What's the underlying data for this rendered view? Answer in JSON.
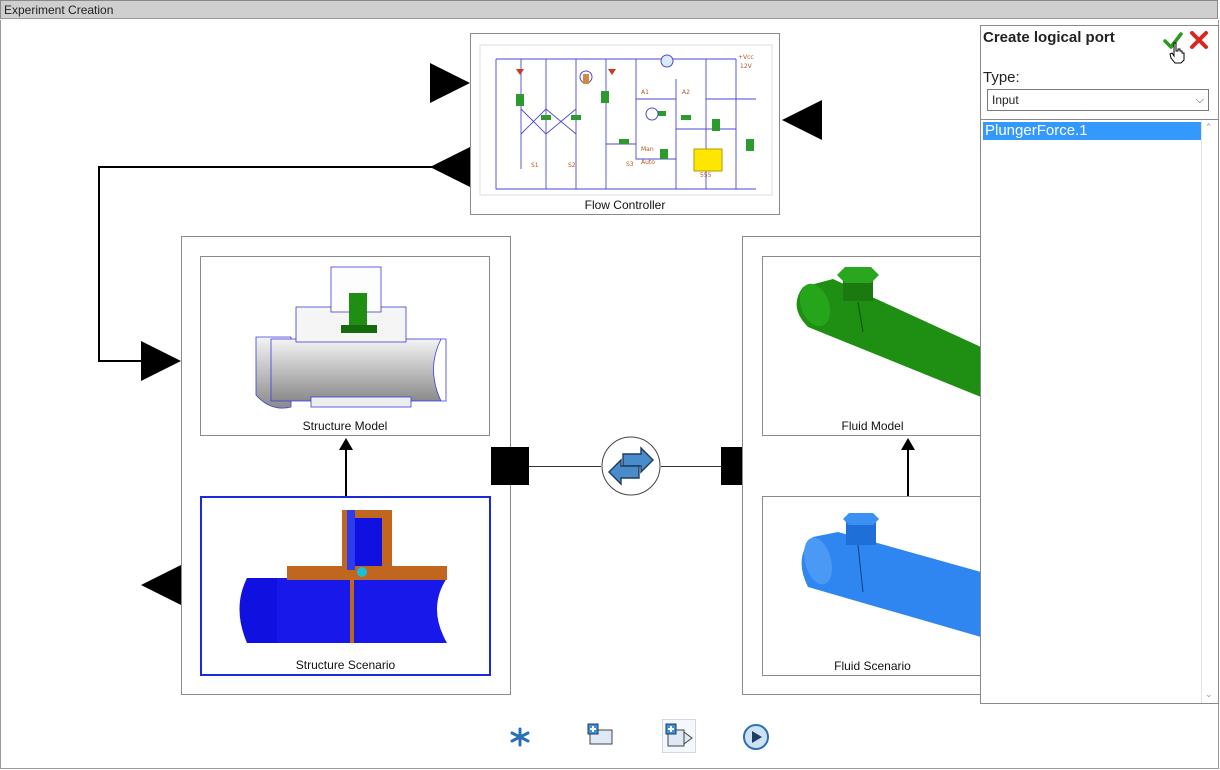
{
  "window": {
    "title": "Experiment Creation"
  },
  "nodes": {
    "flow_controller": "Flow Controller",
    "structure_model": "Structure Model",
    "structure_scenario": "Structure Scenario",
    "fluid_model": "Fluid Model",
    "fluid_scenario": "Fluid Scenario"
  },
  "schematic_labels": {
    "vcc": "+Vcc",
    "voltage": "12V",
    "ic": "555",
    "man": "Man",
    "auto": "Auto",
    "a1": "A1",
    "a2": "A2",
    "s1": "S1",
    "s2": "S2",
    "s3": "S3"
  },
  "panel": {
    "title": "Create logical port",
    "type_label": "Type:",
    "type_value": "Input",
    "items": [
      "PlungerForce.1"
    ]
  },
  "toolbar": {
    "icons": [
      "asterisk-icon",
      "add-container-icon",
      "add-container-arrow-icon",
      "play-icon"
    ]
  },
  "colors": {
    "selection_blue": "#3399ff",
    "selected_border": "#1a2bd6",
    "confirm_green": "#2a9a1f",
    "cancel_red": "#d6281e",
    "fluid_green": "#1f8f14",
    "fluid_blue": "#2f86f0"
  }
}
